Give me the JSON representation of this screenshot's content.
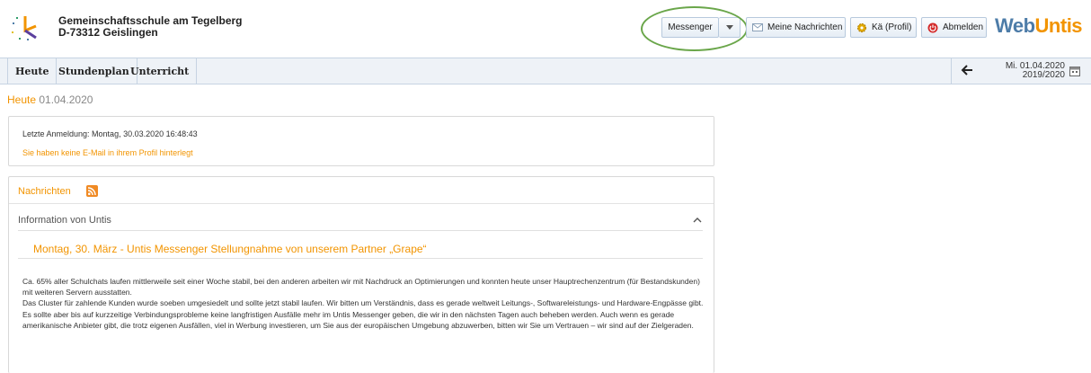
{
  "header": {
    "school_name": "Gemeinschaftsschule am Tegelberg",
    "school_address": "D-73312 Geislingen",
    "messenger_label": "Messenger",
    "nachrichten_label": "Meine Nachrichten",
    "profil_label": "Kä (Profil)",
    "abmelden_label": "Abmelden",
    "brand_web": "Web",
    "brand_untis": "Untis",
    "icons": [
      "dropdown-caret-icon",
      "envelope-icon",
      "gear-icon",
      "power-icon"
    ]
  },
  "nav": {
    "items": [
      {
        "label": "Heute"
      },
      {
        "label": "Stundenplan"
      },
      {
        "label": "Unterricht"
      }
    ],
    "date": "Mi. 01.04.2020",
    "school_year": "2019/2020"
  },
  "page": {
    "title_word": "Heute",
    "title_date": "01.04.2020"
  },
  "login_box": {
    "last_login": "Letzte Anmeldung: Montag, 30.03.2020 16:48:43",
    "warning": "Sie haben keine E-Mail in ihrem Profil hinterlegt"
  },
  "news": {
    "title": "Nachrichten",
    "section_title": "Information von Untis",
    "article_title": "Montag, 30. März - Untis Messenger Stellungnahme von unserem Partner „Grape“",
    "paragraphs": [
      "Ca. 65% aller Schulchats laufen mittlerweile seit einer Woche stabil, bei den anderen arbeiten wir mit Nachdruck an Optimierungen und konnten heute unser Hauptrechenzentrum (für Bestandskunden) mit weiteren Servern ausstatten.",
      "Das Cluster für zahlende Kunden wurde soeben umgesiedelt und sollte jetzt stabil laufen. Wir bitten um Verständnis, dass es gerade weltweit Leitungs-, Softwareleistungs- und Hardware-Engpässe gibt. Es sollte aber bis auf kurzzeitige Verbindungsprobleme keine langfristigen Ausfälle mehr im Untis Messenger geben, die wir in den nächsten Tagen auch beheben werden. Auch wenn es gerade amerikanische Anbieter gibt, die trotz eigenen Ausfällen, viel in Werbung investieren, um Sie aus der europäischen Umgebung abzuwerben, bitten wir Sie um Vertrauen – wir sind auf der Zielgeraden."
    ]
  },
  "colors": {
    "accent_orange": "#f29400",
    "brand_blue": "#4d7ca8",
    "highlight_green": "#6aa64a"
  }
}
